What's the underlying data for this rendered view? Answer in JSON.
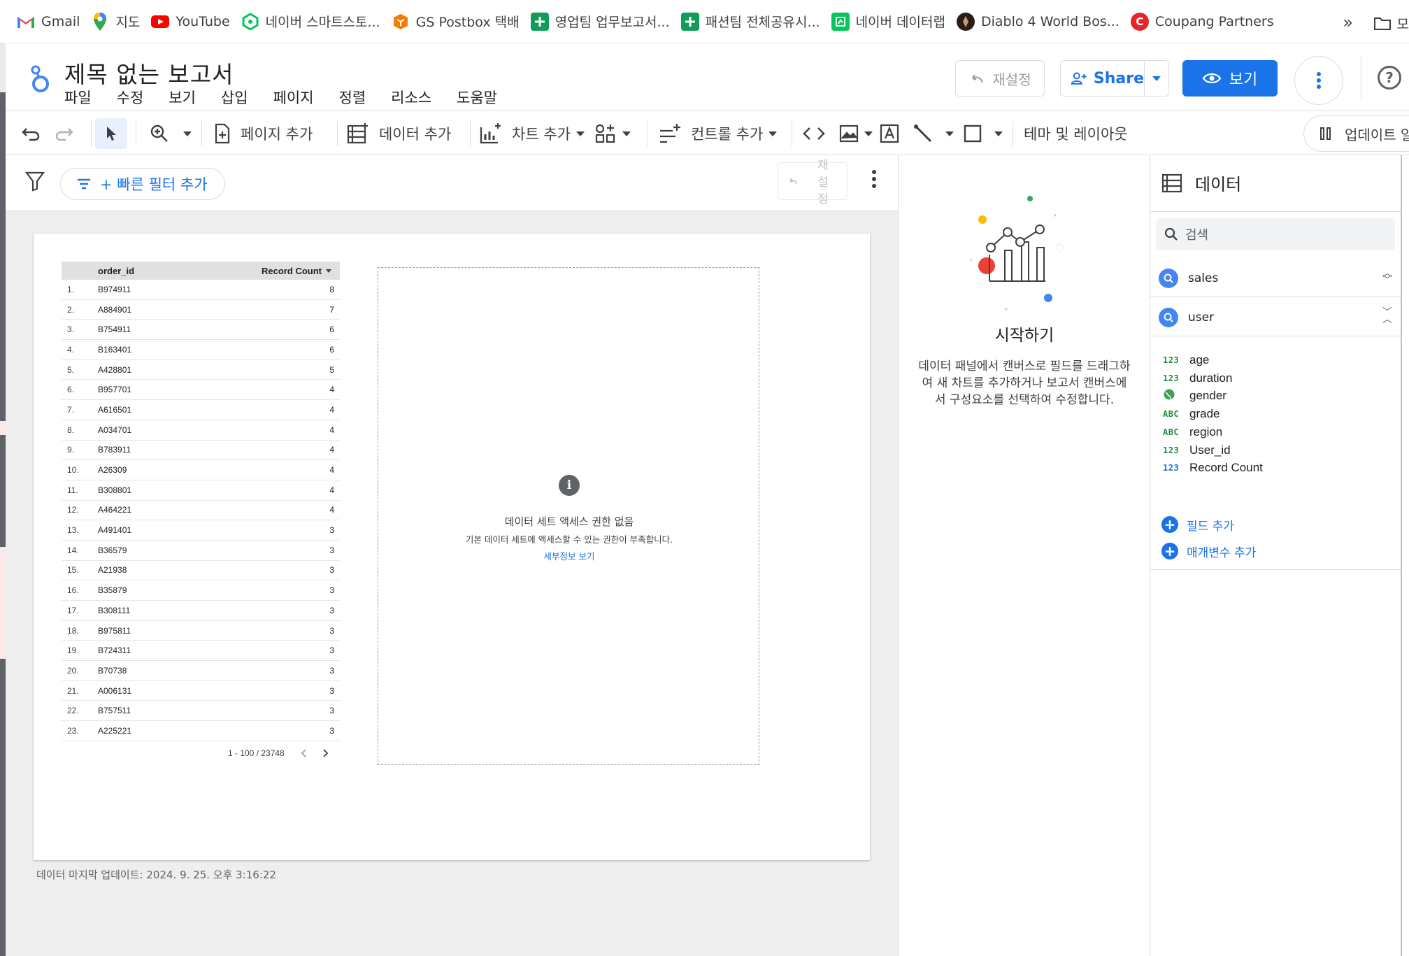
{
  "bookmarks": [
    {
      "label": "Gmail",
      "icon": "gmail-icon",
      "color": "#ea4335"
    },
    {
      "label": "지도",
      "icon": "maps-icon",
      "color": "#34a853"
    },
    {
      "label": "YouTube",
      "icon": "youtube-icon",
      "color": "#ff0000"
    },
    {
      "label": "네이버 스마트스토...",
      "icon": "smartstore-icon",
      "color": "#03c75a"
    },
    {
      "label": "GS Postbox 택배",
      "icon": "postbox-icon",
      "color": "#f57c00"
    },
    {
      "label": "영업팀 업무보고서...",
      "icon": "sheets-icon",
      "color": "#0f9d58"
    },
    {
      "label": "패션팀 전체공유시...",
      "icon": "sheets-icon",
      "color": "#0f9d58"
    },
    {
      "label": "네이버 데이터랩",
      "icon": "datalab-icon",
      "color": "#03c75a"
    },
    {
      "label": "Diablo 4 World Bos...",
      "icon": "diablo-icon",
      "color": "#3c2a21"
    },
    {
      "label": "Coupang Partners",
      "icon": "coupang-icon",
      "color": "#e52528"
    }
  ],
  "bookmarks_more": "»",
  "bookmarks_folder": "모",
  "header": {
    "title": "제목 없는 보고서",
    "menu": [
      "파일",
      "수정",
      "보기",
      "삽입",
      "페이지",
      "정렬",
      "리소스",
      "도움말"
    ],
    "reset_label": "재설정",
    "share_label": "Share",
    "view_label": "보기"
  },
  "toolbar": {
    "add_page": "페이지 추가",
    "add_data": "데이터 추가",
    "add_chart": "차트 추가",
    "add_control": "컨트롤 추가",
    "theme_layout": "테마 및 레이아웃",
    "update": "업데이트 일시"
  },
  "filterbar": {
    "quick_filter": "+ 빠른 필터 추가",
    "mini_reset": "재설정"
  },
  "table": {
    "col_dim": "order_id",
    "col_metric": "Record Count",
    "rows": [
      {
        "n": "1.",
        "id": "B974911",
        "count": "8"
      },
      {
        "n": "2.",
        "id": "A884901",
        "count": "7"
      },
      {
        "n": "3.",
        "id": "B754911",
        "count": "6"
      },
      {
        "n": "4.",
        "id": "B163401",
        "count": "6"
      },
      {
        "n": "5.",
        "id": "A428801",
        "count": "5"
      },
      {
        "n": "6.",
        "id": "B957701",
        "count": "4"
      },
      {
        "n": "7.",
        "id": "A616501",
        "count": "4"
      },
      {
        "n": "8.",
        "id": "A034701",
        "count": "4"
      },
      {
        "n": "9.",
        "id": "B783911",
        "count": "4"
      },
      {
        "n": "10.",
        "id": "A26309",
        "count": "4"
      },
      {
        "n": "11.",
        "id": "B308801",
        "count": "4"
      },
      {
        "n": "12.",
        "id": "A464221",
        "count": "4"
      },
      {
        "n": "13.",
        "id": "A491401",
        "count": "3"
      },
      {
        "n": "14.",
        "id": "B36579",
        "count": "3"
      },
      {
        "n": "15.",
        "id": "A21938",
        "count": "3"
      },
      {
        "n": "16.",
        "id": "B35879",
        "count": "3"
      },
      {
        "n": "17.",
        "id": "B308111",
        "count": "3"
      },
      {
        "n": "18.",
        "id": "B975811",
        "count": "3"
      },
      {
        "n": "19.",
        "id": "B724311",
        "count": "3"
      },
      {
        "n": "20.",
        "id": "B70738",
        "count": "3"
      },
      {
        "n": "21.",
        "id": "A006131",
        "count": "3"
      },
      {
        "n": "22.",
        "id": "B757511",
        "count": "3"
      },
      {
        "n": "23.",
        "id": "A225221",
        "count": "3"
      }
    ],
    "pagination": "1 - 100 / 23748"
  },
  "chart_error": {
    "title": "데이터 세트 액세스 권한 없음",
    "message": "기본 데이터 세트에 액세스할 수 있는 권한이 부족합니다.",
    "link": "세부정보 보기"
  },
  "footer": "데이터 마지막 업데이트: 2024. 9. 25. 오후 3:16:22",
  "getting_started": {
    "title": "시작하기",
    "body": "데이터 패널에서 캔버스로 필드를 드래그하여 새 차트를 추가하거나 보고서 캔버스에서 구성요소를 선택하여 수정합니다."
  },
  "data_panel": {
    "title": "데이터",
    "search_placeholder": "검색",
    "sources": [
      "sales",
      "user"
    ],
    "fields": [
      {
        "type": "123",
        "name": "age"
      },
      {
        "type": "123",
        "name": "duration"
      },
      {
        "type": "geo",
        "name": "gender"
      },
      {
        "type": "ABC",
        "name": "grade"
      },
      {
        "type": "ABC",
        "name": "region"
      },
      {
        "type": "123",
        "name": "User_id"
      },
      {
        "type": "123",
        "name": "Record Count"
      }
    ],
    "add_field": "필드 추가",
    "add_parameter": "매개변수 추가"
  }
}
